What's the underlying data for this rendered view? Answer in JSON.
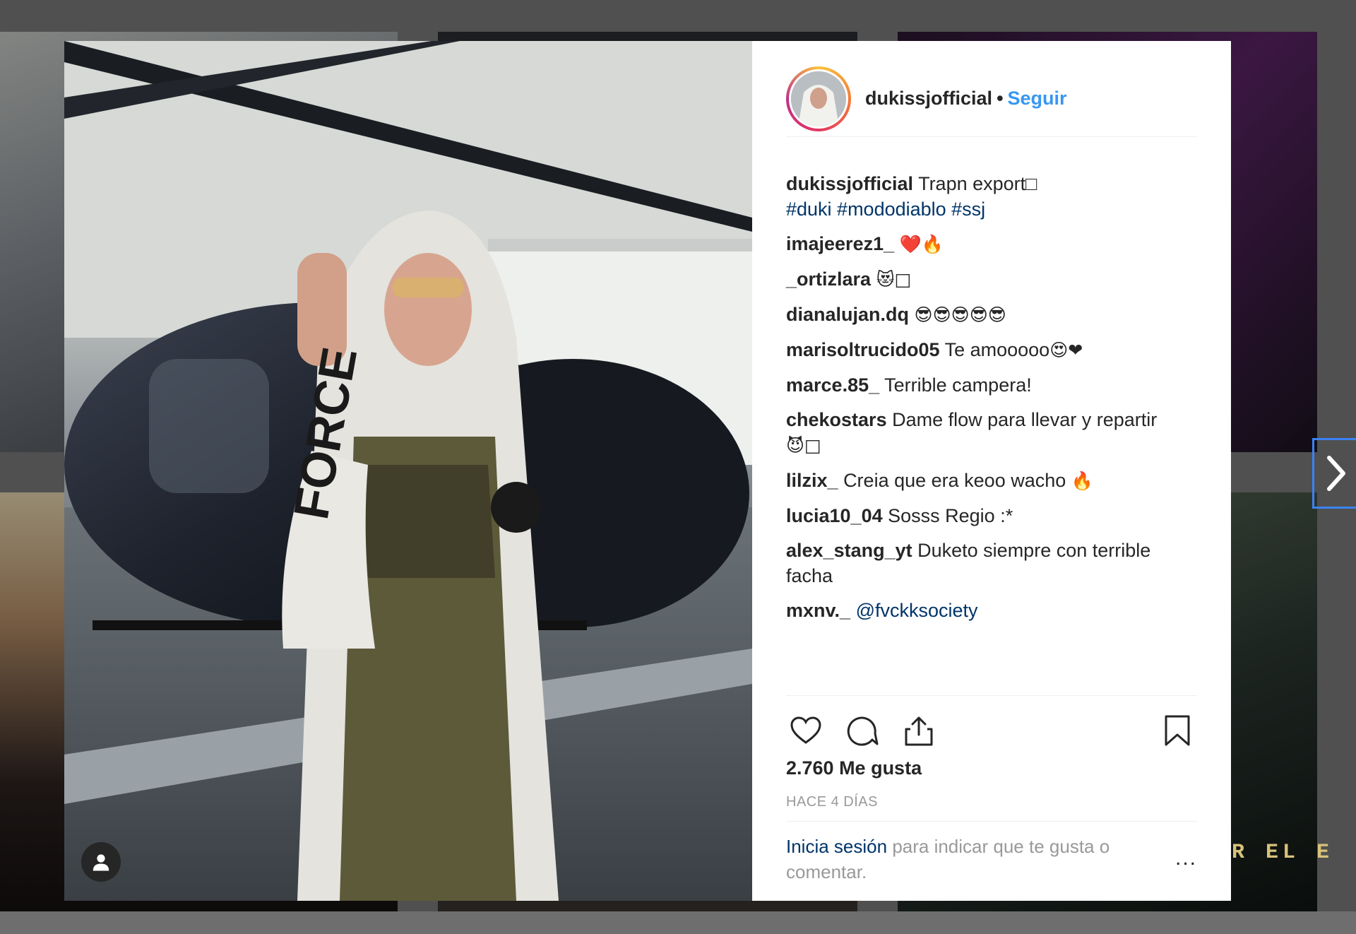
{
  "post": {
    "username": "dukissjofficial",
    "follow_label": "Seguir",
    "caption": {
      "user": "dukissjofficial",
      "text": "Trapn export",
      "trail": "□",
      "hashtags": "#duki #mododiablo #ssj"
    },
    "comments": [
      {
        "user": "imajeerez1_",
        "text": "",
        "emoji": "❤️🔥"
      },
      {
        "user": "_ortizlara",
        "text": "",
        "emoji": "😻□"
      },
      {
        "user": "dianalujan.dq",
        "text": "",
        "emoji": "😎😎😎😎😎"
      },
      {
        "user": "marisoltrucido05",
        "text": "Te amooooo",
        "emoji": "😍❤"
      },
      {
        "user": "marce.85_",
        "text": "Terrible campera!",
        "emoji": ""
      },
      {
        "user": "chekostars",
        "text": "Dame flow para llevar y repartir",
        "emoji": "😈□"
      },
      {
        "user": "lilzix_",
        "text": "Creia que era keoo wacho",
        "emoji": "🔥"
      },
      {
        "user": "lucia10_04",
        "text": "Sosss Regio :*",
        "emoji": ""
      },
      {
        "user": "alex_stang_yt",
        "text": "Duketo siempre con terrible facha",
        "emoji": ""
      },
      {
        "user": "mxnv._",
        "text": "",
        "mention": "@fvckksociety",
        "emoji": ""
      }
    ],
    "likes": "2.760 Me gusta",
    "time": "HACE 4 DÍAS",
    "login_link": "Inicia sesión",
    "login_rest": "para indicar que te gusta o comentar.",
    "more": "..."
  },
  "background": {
    "banner_text": "R EL E"
  },
  "icons": {
    "like": "heart-icon",
    "comment": "comment-icon",
    "share": "share-icon",
    "save": "bookmark-icon",
    "next": "chevron-right-icon",
    "user": "user-icon"
  },
  "colors": {
    "link": "#3897f0",
    "hashtag": "#003569",
    "meta": "#999999"
  }
}
